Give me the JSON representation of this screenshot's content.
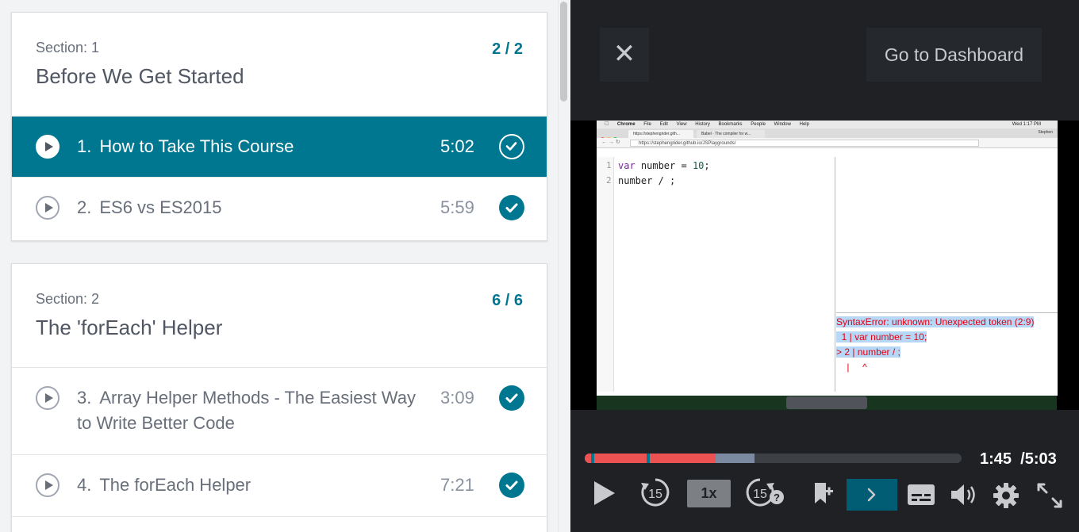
{
  "sections": [
    {
      "label": "Section: 1",
      "title": "Before We Get Started",
      "progress": "2 / 2",
      "lectures": [
        {
          "num": "1.",
          "title": "How to Take This Course",
          "duration": "5:02",
          "active": true,
          "completed": true
        },
        {
          "num": "2.",
          "title": "ES6 vs ES2015",
          "duration": "5:59",
          "active": false,
          "completed": true
        }
      ]
    },
    {
      "label": "Section: 2",
      "title": "The 'forEach' Helper",
      "progress": "6 / 6",
      "lectures": [
        {
          "num": "3.",
          "title_line1": "Array Helper Methods - The Easiest Way",
          "title_line2": "to Write Better Code",
          "duration": "3:09",
          "active": false,
          "completed": true
        },
        {
          "num": "4.",
          "title": "The forEach Helper",
          "duration": "7:21",
          "active": false,
          "completed": true
        }
      ]
    }
  ],
  "player": {
    "close_icon": "close-icon",
    "dashboard_label": "Go to Dashboard",
    "current_time": "1:45",
    "total_time": "/5:03",
    "played_fraction": 0.347,
    "buffered_fraction": 0.45,
    "playback_rate": "1x",
    "rewind_seconds": "15",
    "forward_seconds": "15",
    "icons": [
      "play-icon",
      "rewind-15-icon",
      "forward-15-icon",
      "add-bookmark-icon",
      "next-icon",
      "captions-icon",
      "volume-icon",
      "settings-icon",
      "fullscreen-icon"
    ],
    "accent_color": "#007791",
    "played_color": "#ec5252"
  },
  "video_frame": {
    "menu_items": [
      "Chrome",
      "File",
      "Edit",
      "View",
      "History",
      "Bookmarks",
      "People",
      "Window",
      "Help"
    ],
    "clock": "Wed 1:17 PM",
    "tabs": [
      "https://stephengrider.gith...",
      "Babel · The compiler for w..."
    ],
    "tab_user": "Stephen",
    "url": "https://stephengrider.github.io/JSPlaygrounds/",
    "code_lines": [
      {
        "ln": "1",
        "kw": "var",
        "rest": " number = ",
        "num": "10",
        "end": ";"
      },
      {
        "ln": "2",
        "text": "number / ;"
      }
    ],
    "error_lines": [
      "SyntaxError: unknown: Unexpected token (2:9)",
      "  1 | var number = 10;",
      "> 2 | number / ;",
      "    |     ^"
    ]
  }
}
